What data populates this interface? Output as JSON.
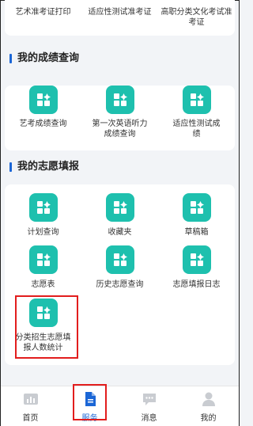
{
  "top_row": [
    {
      "label": "艺术准考证打印"
    },
    {
      "label": "适应性测试准考证"
    },
    {
      "label": "高职分类文化考试准考证"
    }
  ],
  "grades_section": {
    "title": "我的成绩查询",
    "items": [
      {
        "label": "艺考成绩查询"
      },
      {
        "label": "第一次英语听力成绩查询"
      },
      {
        "label": "适应性测试成绩"
      }
    ]
  },
  "wish_section": {
    "title": "我的志愿填报",
    "items": [
      {
        "label": "计划查询"
      },
      {
        "label": "收藏夹"
      },
      {
        "label": "草稿箱"
      },
      {
        "label": "志愿表"
      },
      {
        "label": "历史志愿查询"
      },
      {
        "label": "志愿填报日志"
      },
      {
        "label": "分类招生志愿填报人数统计"
      }
    ]
  },
  "tabbar": {
    "tabs": [
      {
        "label": "首页",
        "icon": "home-chart-icon"
      },
      {
        "label": "服务",
        "icon": "document-icon"
      },
      {
        "label": "消息",
        "icon": "chat-bubble-icon"
      },
      {
        "label": "我的",
        "icon": "person-icon"
      }
    ],
    "active_index": 1
  },
  "colors": {
    "tile": "#1ec0ae",
    "accent": "#1b66d6",
    "highlight": "#e21d1d"
  }
}
